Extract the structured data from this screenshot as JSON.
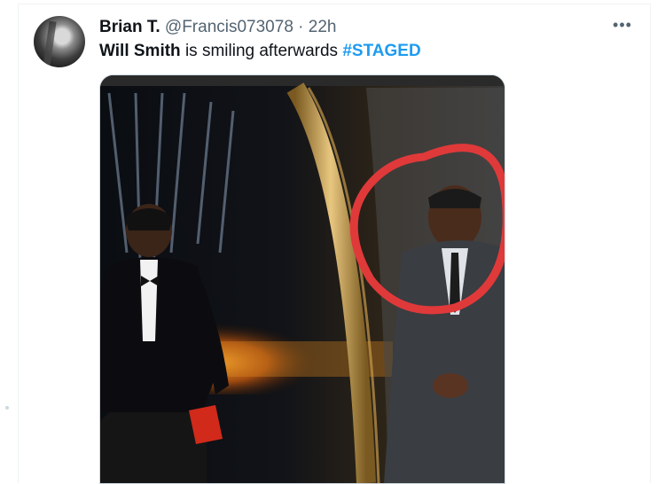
{
  "tweet": {
    "author_name": "Brian T.",
    "handle": "@Francis073078",
    "separator": "·",
    "time": "22h",
    "text": {
      "bold_part": "Will Smith",
      "plain_part": " is smiling afterwards ",
      "hashtag": "#STAGED"
    },
    "more_icon": "more-horizontal-icon",
    "colors": {
      "hashtag": "#1d9bf0",
      "secondary": "#536471",
      "circle": "#e0393a"
    }
  }
}
